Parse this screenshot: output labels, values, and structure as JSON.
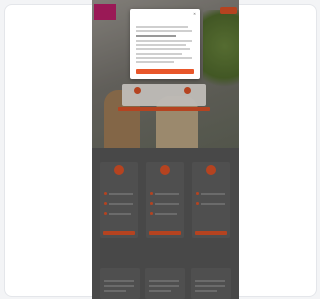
{
  "colors": {
    "accent": "#e8562a",
    "brand": "#c6206f",
    "hero": "#8a8780"
  },
  "icons": [
    "close-icon",
    "check-icon"
  ],
  "site": {
    "logo_text": "",
    "nav_button": ""
  },
  "hero": {
    "links": [
      "",
      ""
    ]
  },
  "sections": {
    "offers_title": "",
    "offers": [
      {
        "title": ""
      },
      {
        "title": ""
      },
      {
        "title": ""
      }
    ],
    "news_title": "",
    "news": [
      {
        "title": ""
      },
      {
        "title": ""
      },
      {
        "title": ""
      }
    ]
  },
  "modal": {
    "title": "",
    "subtitle": "",
    "accept_label": ""
  }
}
